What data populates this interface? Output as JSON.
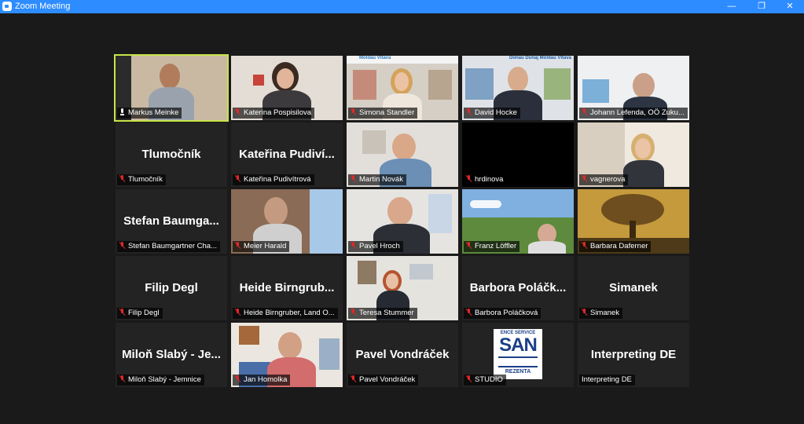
{
  "window": {
    "title": "Zoom Meeting",
    "min_glyph": "—",
    "max_glyph": "❐",
    "close_glyph": "✕",
    "accent": "#2d8cff"
  },
  "active_speaker_color": "#c8e54a",
  "tiles": [
    {
      "label": "Markus Meinke",
      "mic": "live"
    },
    {
      "label": "Katerina Pospisilova",
      "mic": "muted"
    },
    {
      "label": "Simona Standler",
      "mic": "muted",
      "banner": "Moldau Vltava"
    },
    {
      "label": "David Hocke",
      "mic": "muted",
      "banner": "Donau Dunaj Moldau Vltava"
    },
    {
      "label": "Johann Lefenda, OÖ Zuku...",
      "mic": "muted"
    },
    {
      "label": "Tlumočník",
      "mic": "muted",
      "big": "Tlumočník"
    },
    {
      "label": "Kateřina Pudivítrová",
      "mic": "muted",
      "big": "Kateřina Pudiví..."
    },
    {
      "label": "Martin Novák",
      "mic": "muted"
    },
    {
      "label": "hrdinova",
      "mic": "muted"
    },
    {
      "label": "vagnerova",
      "mic": "muted"
    },
    {
      "label": "Stefan Baumgartner Cha...",
      "mic": "muted",
      "big": "Stefan Baumga..."
    },
    {
      "label": "Meier Harald",
      "mic": "muted"
    },
    {
      "label": "Pavel Hroch",
      "mic": "muted"
    },
    {
      "label": "Franz Löffler",
      "mic": "muted"
    },
    {
      "label": "Barbara Daferner",
      "mic": "muted"
    },
    {
      "label": "Filip Degl",
      "mic": "muted",
      "big": "Filip Degl"
    },
    {
      "label": "Heide Birngruber, Land O...",
      "mic": "muted",
      "big": "Heide Birngrub..."
    },
    {
      "label": "Teresa Stummer",
      "mic": "muted"
    },
    {
      "label": "Barbora Poláčková",
      "mic": "muted",
      "big": "Barbora Poláčk..."
    },
    {
      "label": "Simanek",
      "mic": "muted",
      "big": "Simanek"
    },
    {
      "label": "Miloň Slabý - Jemnice",
      "mic": "muted",
      "big": "Miloň Slabý - Je..."
    },
    {
      "label": "Jan Homolka",
      "mic": "muted"
    },
    {
      "label": "Pavel Vondráček",
      "mic": "muted",
      "big": "Pavel Vondráček"
    },
    {
      "label": "STUDIO",
      "mic": "muted",
      "logo_top": "ENCE SERVICE",
      "logo_mid": "SAN",
      "logo_bot": "REZENTA"
    },
    {
      "label": "Interpreting DE",
      "mic": "none",
      "big": "Interpreting DE"
    }
  ]
}
